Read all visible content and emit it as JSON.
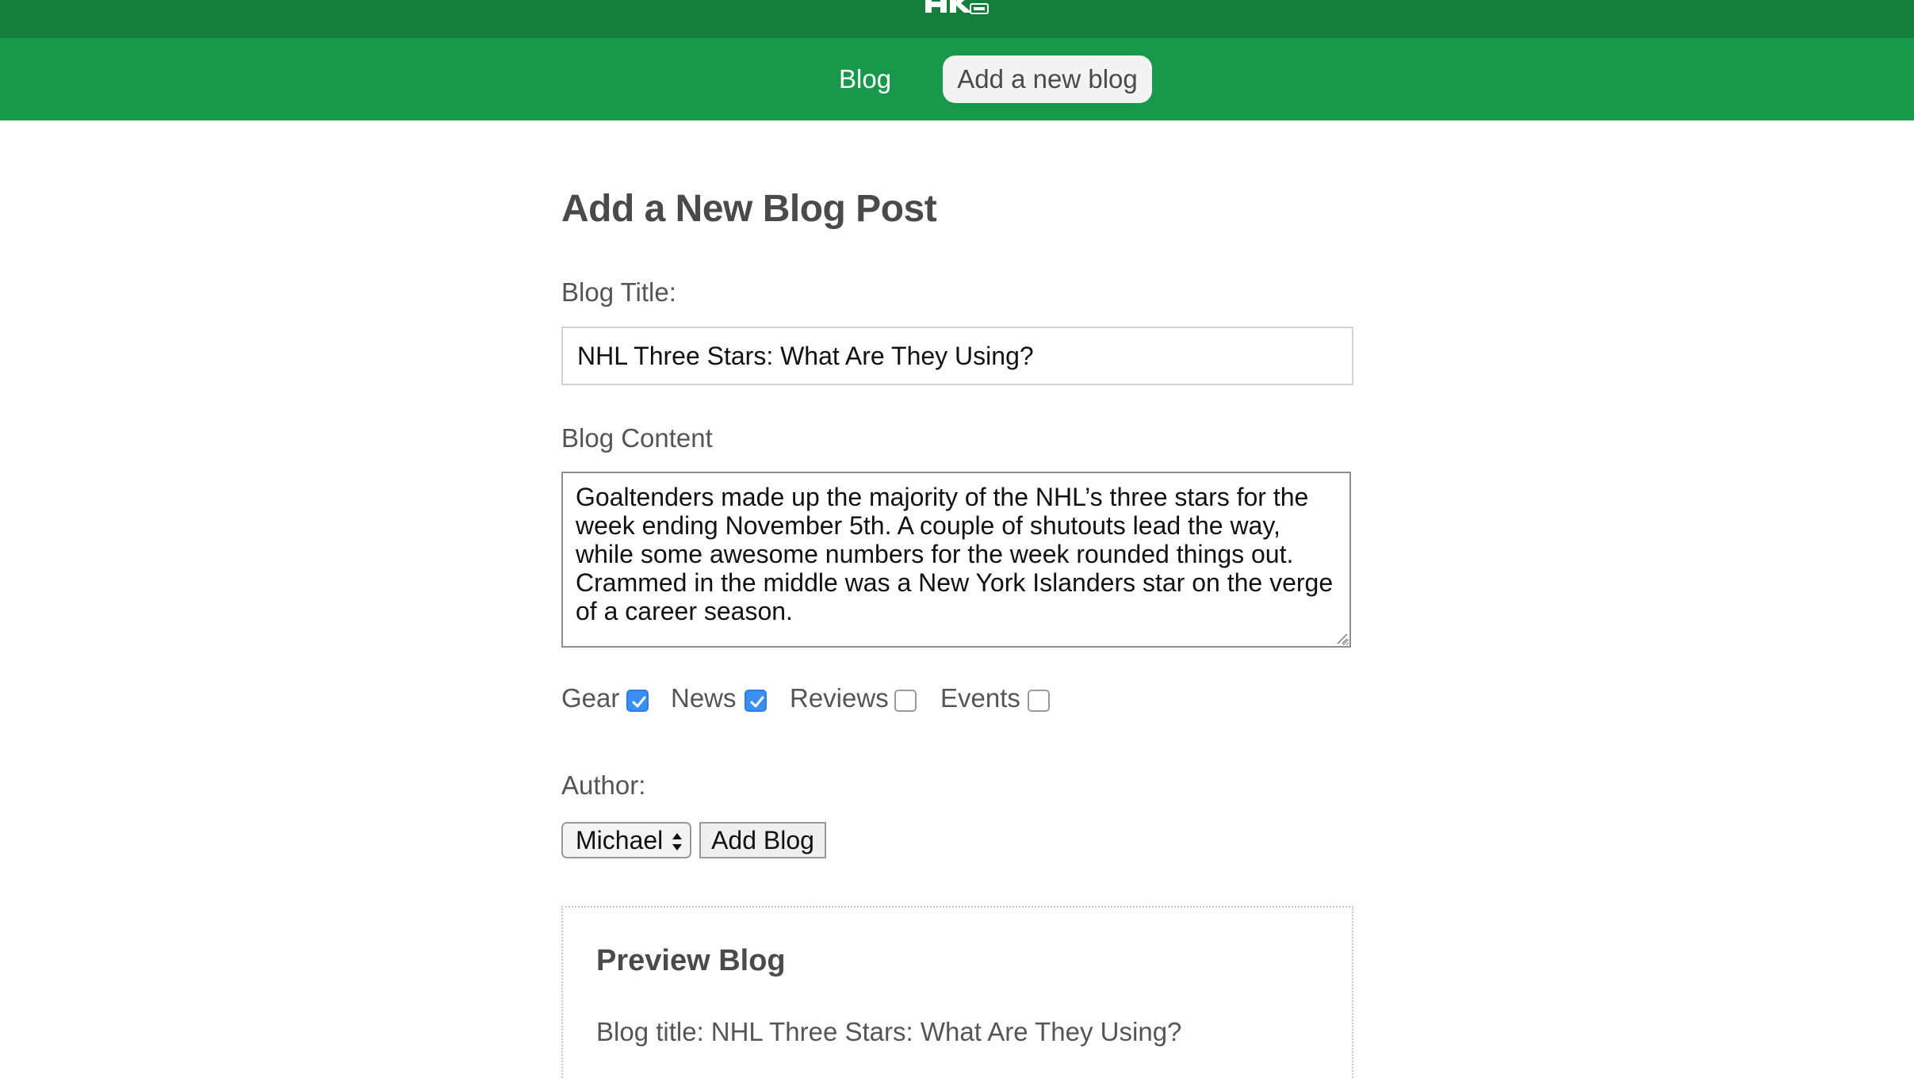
{
  "nav": {
    "blog_label": "Blog",
    "add_label": "Add a new blog"
  },
  "form": {
    "heading": "Add a New Blog Post",
    "title_label": "Blog Title:",
    "title_value": "NHL Three Stars: What Are They Using?",
    "content_label": "Blog Content",
    "content_value": "Goaltenders made up the majority of the NHL’s three stars for the week ending November 5th. A couple of shutouts lead the way, while some awesome numbers for the week rounded things out. Crammed in the middle was a New York Islanders star on the verge of a career season.",
    "categories": [
      {
        "label": "Gear",
        "checked": true
      },
      {
        "label": "News",
        "checked": true
      },
      {
        "label": "Reviews",
        "checked": false
      },
      {
        "label": "Events",
        "checked": false
      }
    ],
    "author_label": "Author:",
    "author_selected": "Michael",
    "add_button_label": "Add Blog"
  },
  "preview": {
    "heading": "Preview Blog",
    "title_prefix": "Blog title:",
    "title_value": "NHL Three Stars: What Are They Using?"
  },
  "colors": {
    "top_bar": "#137f3b",
    "nav_bar": "#17984a",
    "checkbox_checked": "#3b8ff0"
  }
}
